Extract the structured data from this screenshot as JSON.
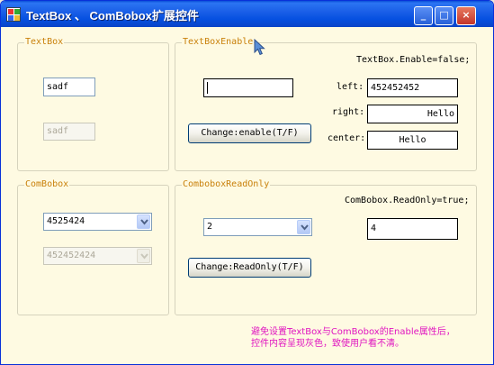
{
  "window": {
    "title": "TextBox 、 ComBobox扩展控件",
    "minimize_glyph": "_",
    "maximize_glyph": "□",
    "close_glyph": "×"
  },
  "groups": {
    "textbox": {
      "title": "TextBox",
      "enabled_value": "sadf",
      "disabled_value": "sadf"
    },
    "textbox_enable": {
      "title": "TextBoxEnable",
      "info": "TextBox.Enable=false;",
      "edit_value": "",
      "left_label": "left:",
      "left_value": "452452452",
      "right_label": "right:",
      "right_value": "Hello",
      "center_label": "center:",
      "center_value": "Hello",
      "toggle_button": "Change:enable(T/F)"
    },
    "combobox": {
      "title": "ComBobox",
      "enabled_value": "4525424",
      "disabled_value": "452452424"
    },
    "combobox_readonly": {
      "title": "ComboboxReadOnly",
      "info": "ComBobox.ReadOnly=true;",
      "combo_value": "2",
      "text_value": "4",
      "toggle_button": "Change:ReadOnly(T/F)"
    }
  },
  "note": {
    "line1": "避免设置TextBox与ComBobox的Enable属性后，",
    "line2": "控件内容呈现灰色，致使用户看不清。"
  },
  "colors": {
    "titlebar": "#0a4fd9",
    "client_background": "#fefae2",
    "group_title": "#c9800a",
    "note_text": "#e014c0"
  }
}
